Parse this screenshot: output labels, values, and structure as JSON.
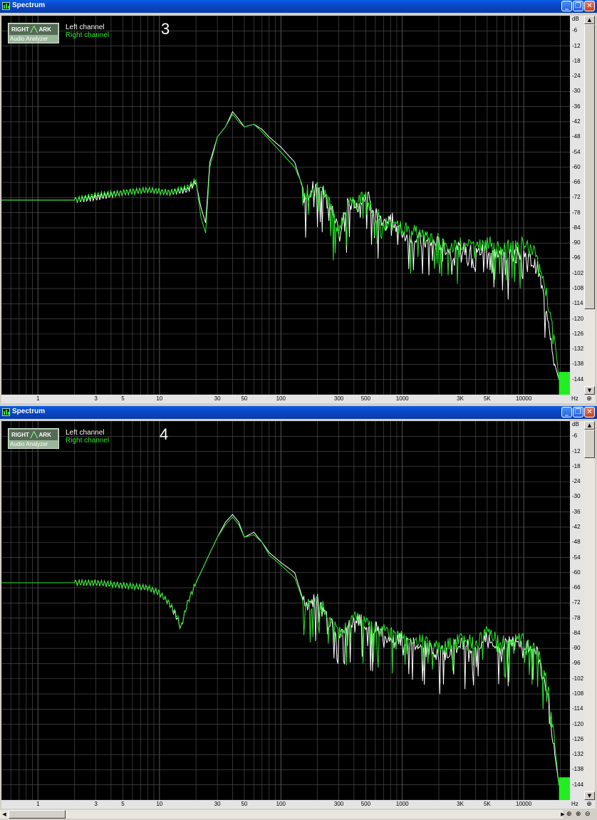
{
  "windows": [
    {
      "title": "Spectrum",
      "number": "3",
      "logo": {
        "top": "RIGHT",
        "mark": "ARK",
        "bottom": "Audio Analyzer"
      },
      "legend": {
        "left": "Left channel",
        "right": "Right channel"
      }
    },
    {
      "title": "Spectrum",
      "number": "4",
      "logo": {
        "top": "RIGHT",
        "mark": "ARK",
        "bottom": "Audio Analyzer"
      },
      "legend": {
        "left": "Left channel",
        "right": "Right channel"
      }
    }
  ],
  "axis": {
    "db_unit": "dB",
    "hz_unit": "Hz",
    "db_ticks": [
      "-6",
      "-12",
      "-18",
      "-24",
      "-30",
      "-36",
      "-42",
      "-48",
      "-54",
      "-60",
      "-66",
      "-72",
      "-78",
      "-84",
      "-90",
      "-96",
      "-102",
      "-108",
      "-114",
      "-120",
      "-126",
      "-132",
      "-138",
      "-144"
    ],
    "hz_ticks": [
      "1",
      "3",
      "5",
      "10",
      "30",
      "50",
      "100",
      "300",
      "500",
      "1000",
      "3K",
      "5K",
      "10000"
    ]
  },
  "colors": {
    "left": "#ffffff",
    "right": "#22ee22",
    "grid": "#555555",
    "background": "#000000"
  },
  "chart_data": [
    {
      "type": "line",
      "xscale": "log",
      "xlim": [
        0.5,
        24000
      ],
      "ylim": [
        -150,
        0
      ],
      "series": [
        {
          "name": "Left channel",
          "x": [
            0.5,
            1,
            2,
            3,
            5,
            8,
            12,
            17,
            20,
            22,
            24,
            26,
            30,
            35,
            40,
            45,
            50,
            60,
            70,
            80,
            100,
            130,
            160,
            200,
            240,
            280,
            300,
            360,
            420,
            500,
            600,
            700,
            800,
            1000,
            1300,
            1600,
            2000,
            2600,
            3000,
            4000,
            5000,
            6000,
            8000,
            10000,
            13000,
            16000,
            18000,
            19500,
            20500,
            24000
          ],
          "y": [
            -73,
            -73,
            -73,
            -72,
            -70,
            -69,
            -70,
            -69,
            -66,
            -76,
            -82,
            -58,
            -48,
            -44,
            -38,
            -41,
            -44,
            -43,
            -45,
            -48,
            -52,
            -58,
            -72,
            -66,
            -72,
            -80,
            -88,
            -73,
            -76,
            -70,
            -78,
            -84,
            -80,
            -86,
            -88,
            -90,
            -90,
            -94,
            -92,
            -94,
            -92,
            -94,
            -95,
            -94,
            -100,
            -120,
            -138,
            -144,
            -144,
            -144
          ]
        },
        {
          "name": "Right channel",
          "x": [
            0.5,
            1,
            2,
            3,
            5,
            8,
            12,
            17,
            20,
            22,
            24,
            26,
            30,
            35,
            40,
            45,
            50,
            60,
            70,
            80,
            100,
            130,
            160,
            200,
            240,
            280,
            300,
            360,
            420,
            500,
            600,
            700,
            800,
            1000,
            1300,
            1600,
            2000,
            2600,
            3000,
            4000,
            5000,
            6000,
            8000,
            10000,
            13000,
            16000,
            18000,
            19500,
            20500,
            24000
          ],
          "y": [
            -73,
            -73,
            -73,
            -71,
            -70,
            -69,
            -70,
            -68,
            -65,
            -80,
            -86,
            -60,
            -48,
            -44,
            -39,
            -42,
            -44,
            -43,
            -46,
            -49,
            -54,
            -60,
            -70,
            -68,
            -72,
            -82,
            -86,
            -74,
            -74,
            -72,
            -78,
            -82,
            -82,
            -84,
            -86,
            -88,
            -88,
            -92,
            -90,
            -92,
            -90,
            -90,
            -92,
            -90,
            -94,
            -114,
            -128,
            -144,
            -144,
            -144
          ]
        }
      ]
    },
    {
      "type": "line",
      "xscale": "log",
      "xlim": [
        0.5,
        24000
      ],
      "ylim": [
        -150,
        0
      ],
      "series": [
        {
          "name": "Left channel",
          "x": [
            0.5,
            1,
            2,
            3,
            5,
            8,
            10,
            12,
            14,
            15,
            17,
            20,
            25,
            30,
            35,
            40,
            45,
            50,
            60,
            70,
            80,
            100,
            130,
            160,
            200,
            250,
            300,
            400,
            500,
            600,
            800,
            1000,
            1300,
            1600,
            2000,
            2600,
            3000,
            4000,
            5000,
            6000,
            8000,
            10000,
            13000,
            16000,
            18000,
            19500,
            20500,
            24000
          ],
          "y": [
            -64,
            -64,
            -64,
            -64,
            -65,
            -66,
            -68,
            -72,
            -78,
            -82,
            -72,
            -64,
            -54,
            -46,
            -40,
            -37,
            -40,
            -46,
            -44,
            -48,
            -52,
            -56,
            -60,
            -74,
            -70,
            -80,
            -84,
            -78,
            -80,
            -82,
            -86,
            -86,
            -88,
            -90,
            -92,
            -90,
            -88,
            -90,
            -86,
            -88,
            -88,
            -88,
            -92,
            -110,
            -132,
            -144,
            -144,
            -144
          ]
        },
        {
          "name": "Right channel",
          "x": [
            0.5,
            1,
            2,
            3,
            5,
            8,
            10,
            12,
            14,
            15,
            17,
            20,
            25,
            30,
            35,
            40,
            45,
            50,
            60,
            70,
            80,
            100,
            130,
            160,
            200,
            250,
            300,
            400,
            500,
            600,
            800,
            1000,
            1300,
            1600,
            2000,
            2600,
            3000,
            4000,
            5000,
            6000,
            8000,
            10000,
            13000,
            16000,
            18000,
            19500,
            20500,
            24000
          ],
          "y": [
            -64,
            -64,
            -64,
            -64,
            -65,
            -66,
            -68,
            -72,
            -77,
            -82,
            -72,
            -64,
            -54,
            -46,
            -41,
            -38,
            -41,
            -46,
            -45,
            -48,
            -53,
            -57,
            -62,
            -74,
            -70,
            -78,
            -84,
            -78,
            -80,
            -82,
            -84,
            -86,
            -86,
            -88,
            -90,
            -88,
            -86,
            -88,
            -84,
            -86,
            -86,
            -86,
            -90,
            -106,
            -128,
            -144,
            -144,
            -144
          ]
        }
      ]
    }
  ]
}
